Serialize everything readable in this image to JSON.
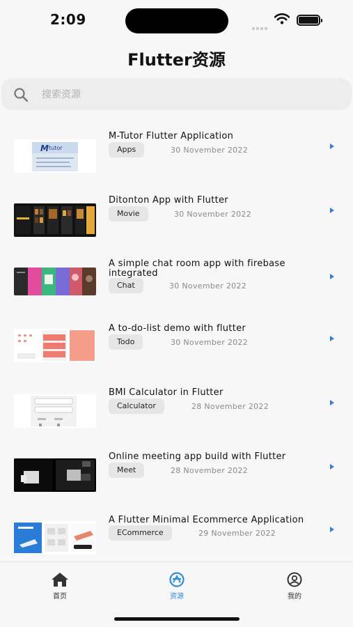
{
  "status_bar": {
    "time": "2:09"
  },
  "header": {
    "title": "Flutter资源"
  },
  "search": {
    "placeholder": "搜索资源"
  },
  "items": [
    {
      "title": "M-Tutor Flutter Application",
      "tag": "Apps",
      "date": "30 November 2022",
      "icon": "play-arrow-icon"
    },
    {
      "title": "Ditonton App with Flutter",
      "tag": "Movie",
      "date": "30 November 2022",
      "icon": "play-arrow-icon"
    },
    {
      "title": "A simple chat room app with firebase integrated",
      "tag": "Chat",
      "date": "30 November 2022",
      "icon": "play-arrow-icon"
    },
    {
      "title": "A to-do-list demo with flutter",
      "tag": "Todo",
      "date": "30 November 2022",
      "icon": "play-arrow-icon"
    },
    {
      "title": "BMI Calculator in Flutter",
      "tag": "Calculator",
      "date": "28 November 2022",
      "icon": "play-arrow-icon"
    },
    {
      "title": "Online meeting app build with Flutter",
      "tag": "Meet",
      "date": "28 November 2022",
      "icon": "play-arrow-icon"
    },
    {
      "title": "A Flutter Minimal Ecommerce Application",
      "tag": "ECommerce",
      "date": "29 November 2022",
      "icon": "play-arrow-icon"
    }
  ],
  "tabbar": {
    "tabs": [
      {
        "label": "首页",
        "icon": "home-icon",
        "active": false
      },
      {
        "label": "资源",
        "icon": "resource-icon",
        "active": true
      },
      {
        "label": "我的",
        "icon": "profile-icon",
        "active": false
      }
    ]
  },
  "colors": {
    "accent": "#2f8bdb",
    "arrow": "#2f7fdb",
    "background": "#f7f7f7"
  }
}
